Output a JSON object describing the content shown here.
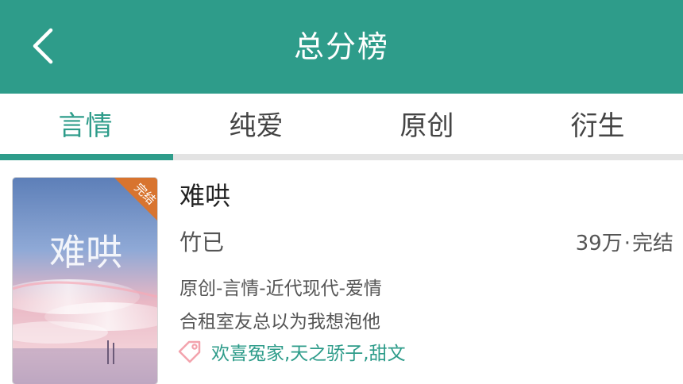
{
  "header": {
    "title": "总分榜",
    "back_icon": "back-arrow-icon",
    "background_color": "#2e9c8a"
  },
  "tabs": [
    {
      "label": "言情",
      "active": true
    },
    {
      "label": "纯爱",
      "active": false
    },
    {
      "label": "原创",
      "active": false
    },
    {
      "label": "衍生",
      "active": false
    }
  ],
  "accent_color": "#2e9c8a",
  "books": [
    {
      "title": "难哄",
      "author": "竹已",
      "word_count": "39万",
      "status": "完结",
      "category": "原创-言情-近代现代-爱情",
      "summary": "合租室友总以为我想泡他",
      "tags": "欢喜冤家,天之骄子,甜文",
      "tag_icon": "tag-icon",
      "cover_badge": "完结",
      "cover_title": "难哄"
    }
  ]
}
